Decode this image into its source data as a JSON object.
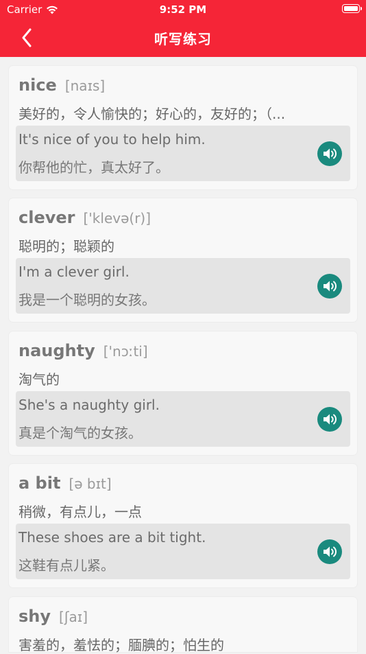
{
  "status": {
    "carrier": "Carrier",
    "time": "9:52 PM"
  },
  "nav": {
    "title": "听写练习"
  },
  "words": [
    {
      "word": "nice",
      "phonetic": "[naɪs]",
      "meaning": "美好的，令人愉快的；好心的，友好的；（...",
      "example_en": "It's nice of you to help him.",
      "example_zh": "你帮他的忙，真太好了。"
    },
    {
      "word": "clever",
      "phonetic": "['klevə(r)]",
      "meaning": "聪明的；聪颖的",
      "example_en": "I'm a clever girl.",
      "example_zh": "我是一个聪明的女孩。"
    },
    {
      "word": "naughty",
      "phonetic": "['nɔːti]",
      "meaning": "淘气的",
      "example_en": "She's a naughty girl.",
      "example_zh": "真是个淘气的女孩。"
    },
    {
      "word": "a bit",
      "phonetic": "[ə bɪt]",
      "meaning": "稍微，有点儿，一点",
      "example_en": "These shoes are a bit tight.",
      "example_zh": "这鞋有点儿紧。"
    },
    {
      "word": "shy",
      "phonetic": "[ʃaɪ]",
      "meaning": "害羞的，羞怯的；腼腆的；怕生的",
      "example_en": "",
      "example_zh": ""
    }
  ]
}
